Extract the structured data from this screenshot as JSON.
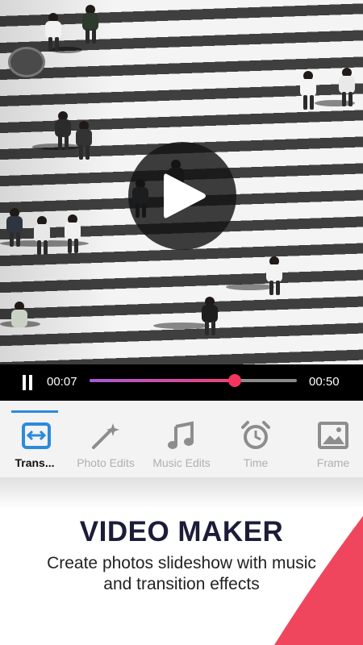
{
  "player": {
    "current_time": "00:07",
    "total_time": "00:50",
    "progress": 0.7
  },
  "toolbar": {
    "tabs": [
      {
        "label": "Trans...",
        "icon": "transition-icon",
        "active": true
      },
      {
        "label": "Photo Edits",
        "icon": "magic-wand-icon",
        "active": false
      },
      {
        "label": "Music Edits",
        "icon": "music-note-icon",
        "active": false
      },
      {
        "label": "Time",
        "icon": "alarm-clock-icon",
        "active": false
      },
      {
        "label": "Frame",
        "icon": "image-frame-icon",
        "active": false
      }
    ]
  },
  "promo": {
    "headline": "VIDEO MAKER",
    "subline_1": "Create photos slideshow with music",
    "subline_2": "and transition effects"
  },
  "colors": {
    "accent_blue": "#2a8bdc",
    "accent_pink": "#f4345f",
    "headline_navy": "#1c1c3a"
  }
}
